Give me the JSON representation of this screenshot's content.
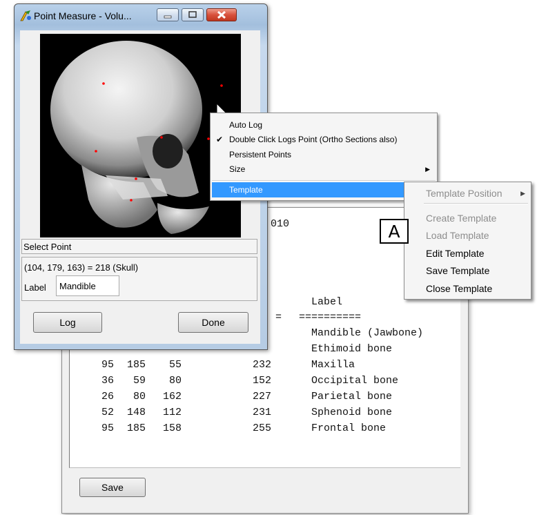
{
  "log_window": {
    "partial_header": "010",
    "label_header": "Label",
    "header_rule_left": "=",
    "header_rule": "==========",
    "rows": [
      {
        "x": "",
        "y": "",
        "z": "",
        "value": "",
        "label": "Mandible (Jawbone)"
      },
      {
        "x": "",
        "y": "",
        "z": "",
        "value": "",
        "label": "Ethimoid bone"
      },
      {
        "x": "95",
        "y": "185",
        "z": "55",
        "value": "232",
        "label": "Maxilla"
      },
      {
        "x": "36",
        "y": "59",
        "z": "80",
        "value": "152",
        "label": "Occipital bone"
      },
      {
        "x": "26",
        "y": "80",
        "z": "162",
        "value": "227",
        "label": "Parietal bone"
      },
      {
        "x": "52",
        "y": "148",
        "z": "112",
        "value": "231",
        "label": "Sphenoid bone"
      },
      {
        "x": "95",
        "y": "185",
        "z": "158",
        "value": "255",
        "label": "Frontal bone"
      }
    ],
    "save_label": "Save"
  },
  "point_measure": {
    "title": "Point Measure - Volu...",
    "select_point_label": "Select Point",
    "coords_text": "(104, 179, 163) = 218 (Skull)",
    "label_caption": "Label",
    "label_value": "Mandible",
    "log_label": "Log",
    "done_label": "Done"
  },
  "context_menu": {
    "items": [
      {
        "label": "Auto Log",
        "checked": false
      },
      {
        "label": "Double Click Logs Point (Ortho Sections also)",
        "checked": true
      },
      {
        "label": "Persistent Points",
        "checked": false
      },
      {
        "label": "Size",
        "checked": false,
        "submenu": true
      }
    ],
    "template_label": "Template",
    "check_glyph": "✔",
    "arrow_glyph": "▶"
  },
  "submenu": {
    "position_label": "Template Position",
    "items": [
      {
        "label": "Create Template",
        "enabled": false
      },
      {
        "label": "Load Template",
        "enabled": false
      },
      {
        "label": "Edit Template",
        "enabled": true
      },
      {
        "label": "Save Template",
        "enabled": true
      },
      {
        "label": "Close Template",
        "enabled": true
      }
    ]
  },
  "callout_label": "A",
  "colors": {
    "menu_highlight": "#3399ff",
    "close_button": "#d8513c",
    "point_marker": "#ff0000"
  }
}
